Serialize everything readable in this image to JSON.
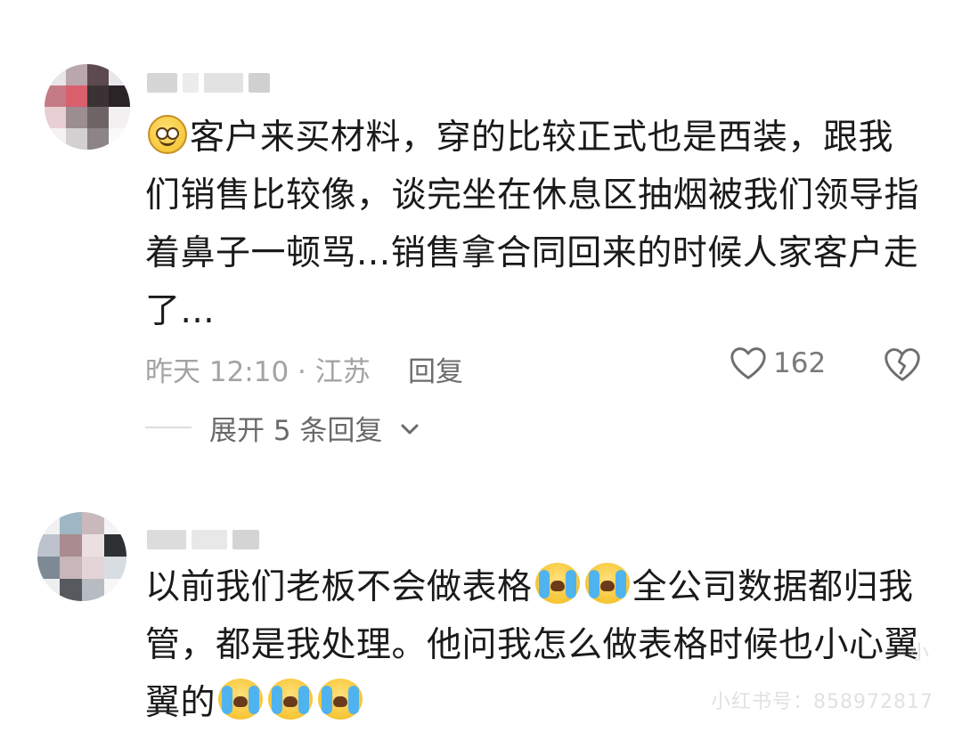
{
  "comments": [
    {
      "lines": [
        "客户来买材料，穿的比较正式也是西装，跟我",
        "们销售比较像，谈完坐在休息区抽烟被我们领导指",
        "着鼻子一顿骂...销售拿合同回来的时候人家客户走",
        "了..."
      ],
      "emoji_lead": "smile-emoji",
      "time_location": "昨天 12:10 · 江苏",
      "reply_label": "回复",
      "like_count": "162",
      "expand_label": "展开 5 条回复"
    },
    {
      "line1_a": "以前我们老板不会做表格",
      "line1_b": "全公司数据都归我",
      "line2": "管，都是我处理。他问我怎么做表格时候也小心翼",
      "line3": "翼的",
      "emoji": "crying-emoji"
    }
  ],
  "watermark": {
    "brand": "小红书号：",
    "id": "858972817",
    "corner": "小"
  },
  "colors": {
    "text_primary": "#1a1a1a",
    "text_meta": "#a3a3a3",
    "text_secondary": "#6a6a6a"
  }
}
